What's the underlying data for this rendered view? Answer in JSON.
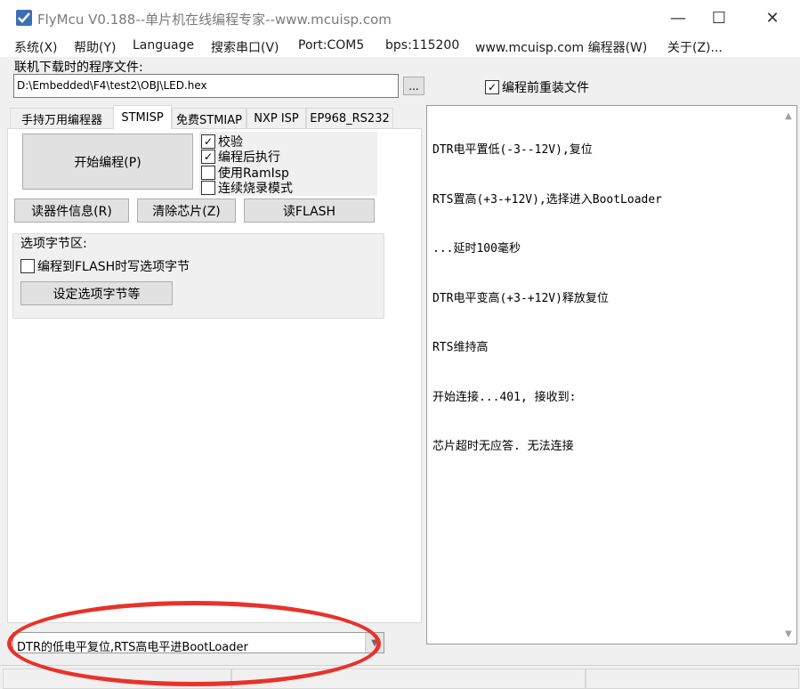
{
  "window": {
    "title": "FlyMcu V0.188--单片机在线编程专家--www.mcuisp.com",
    "controls": {
      "minimize": "—",
      "maximize": "☐",
      "close": "✕"
    }
  },
  "menu": [
    "系统(X)",
    "帮助(Y)",
    "Language",
    "搜索串口(V)",
    "Port:COM5",
    "bps:115200",
    "www.mcuisp.com 编程器(W)",
    "关于(Z)..."
  ],
  "file_section": {
    "label": "联机下载时的程序文件:",
    "path": "D:\\Embedded\\F4\\test2\\OBJ\\LED.hex",
    "browse_label": "...",
    "reload_checked": true,
    "reload_label": "编程前重装文件"
  },
  "tabs": [
    {
      "label": "手持万用编程器",
      "active": false
    },
    {
      "label": "STMISP",
      "active": true
    },
    {
      "label": "免费STMIAP",
      "active": false
    },
    {
      "label": "NXP ISP",
      "active": false
    },
    {
      "label": "EP968_RS232",
      "active": false
    }
  ],
  "stmisp": {
    "start_button": "开始编程(P)",
    "options": [
      {
        "label": "校验",
        "checked": true
      },
      {
        "label": "编程后执行",
        "checked": true
      },
      {
        "label": "使用RamIsp",
        "checked": false
      },
      {
        "label": "连续烧录模式",
        "checked": false
      }
    ],
    "read_info_button": "读器件信息(R)",
    "erase_button": "清除芯片(Z)",
    "read_flash_button": "读FLASH",
    "option_group": {
      "title": "选项字节区:",
      "write_option_label": "编程到FLASH时写选项字节",
      "write_option_checked": false,
      "set_option_button": "设定选项字节等"
    }
  },
  "log_lines": [
    "DTR电平置低(-3--12V),复位",
    "RTS置高(+3-+12V),选择进入BootLoader",
    "...延时100毫秒",
    "DTR电平变高(+3-+12V)释放复位",
    "RTS维持高",
    "开始连接...401, 接收到:",
    "芯片超时无应答. 无法连接"
  ],
  "reset_mode": {
    "selected": "DTR的低电平复位,RTS高电平进BootLoader"
  },
  "colors": {
    "annotation": "#e8322a",
    "app_icon_bg": "#3d6fb4"
  }
}
